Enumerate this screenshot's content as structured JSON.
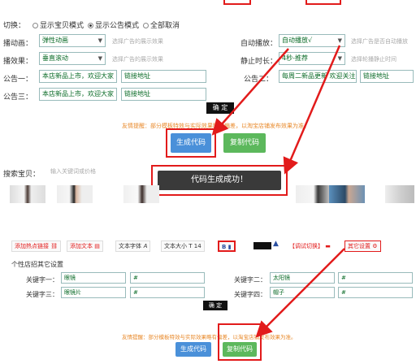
{
  "top": {
    "switch_label": "切换：",
    "radio1": "显示宝贝模式",
    "radio2": "显示公告模式",
    "radio3": "全部取消"
  },
  "settings": {
    "anim_label": "播动画：",
    "anim_value": "弹性动画",
    "anim_hint": "选择广告的展示效果",
    "autoplay_label": "自动播放：",
    "autoplay_value": "自动播放√",
    "autoplay_hint": "选择广告是否自动播放",
    "effect_label": "播效果：",
    "effect_value": "垂直滚动",
    "effect_hint": "选择广告的展示效果",
    "duration_label": "静止时长：",
    "duration_value": "4秒-推荐",
    "duration_hint": "选择轮播静止时间",
    "notice1_label": "公告一：",
    "notice1_value": "本店新品上市，欢迎大家",
    "notice1_link": "链接地址",
    "notice2_label": "公告二：",
    "notice2_value": "每周二新品更新 欢迎关注",
    "notice2_link": "链接地址",
    "notice3_label": "公告三：",
    "notice3_value": "本店新品上市，欢迎大家",
    "notice3_link": "链接地址",
    "ok_button": "确 定"
  },
  "tip1": "友情提醒：部分模板特效与实际效果略有偏差，以淘宝店铺发布效果为准。",
  "buttons1": {
    "generate": "生成代码",
    "copy": "复制代码"
  },
  "search": {
    "label": "搜索宝贝：",
    "placeholder": "输入关键词或价格"
  },
  "toast": "代码生成成功！",
  "toolbar": {
    "add_hotspot": "添加热点链接",
    "add_text": "添加文本",
    "font": "文本字体",
    "size": "文本大小",
    "size_value": "14",
    "bold": "B",
    "debug": "【调试切换】",
    "other": "其它设置"
  },
  "personal": {
    "title": "个性店招其它设置",
    "kw1_label": "关键字一：",
    "kw1_value": "眼镜",
    "kw1_link": "#",
    "kw2_label": "关键字二：",
    "kw2_value": "太阳镜",
    "kw2_link": "#",
    "kw3_label": "关键字三：",
    "kw3_value": "眼镜片",
    "kw3_link": "#",
    "kw4_label": "关键字四：",
    "kw4_value": "帽子",
    "kw4_link": "#",
    "ok_button": "确 定"
  },
  "tip2": "友情提醒：部分模板特效与实际效果略有偏差，以淘宝店铺发布效果为准。",
  "buttons2": {
    "generate": "生成代码",
    "copy": "复制代码"
  },
  "colors": {
    "red": "#e21b1b",
    "blue": "#4a90d9",
    "green": "#5cb85c",
    "value_green": "#0a6b27"
  }
}
